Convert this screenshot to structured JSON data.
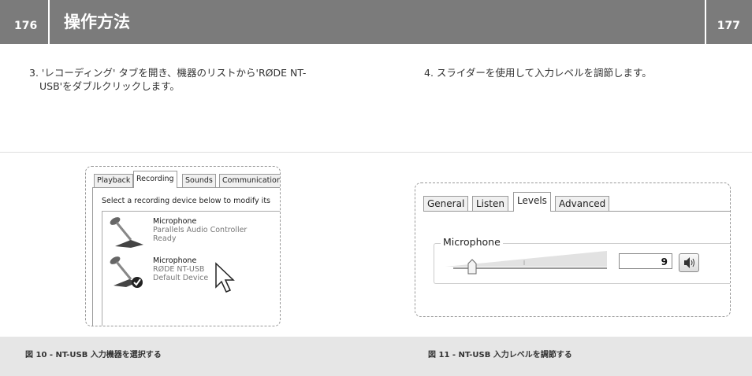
{
  "header": {
    "page_left": "176",
    "page_right": "177",
    "title": "操作方法"
  },
  "steps": [
    {
      "num": "3.",
      "text_line1": "'レコーディング' タブを開き、機器のリストから'RØDE NT-",
      "text_line2": "USB'をダブルクリックします。"
    },
    {
      "num": "4.",
      "text": "スライダーを使用して入力レベルを調節します。"
    }
  ],
  "recording_dialog": {
    "tabs": [
      "Playback",
      "Recording",
      "Sounds",
      "Communications"
    ],
    "active_tab": "Recording",
    "hint": "Select a recording device below to modify its",
    "devices": [
      {
        "name": "Microphone",
        "detail": "Parallels Audio Controller",
        "status": "Ready"
      },
      {
        "name": "Microphone",
        "detail": "RØDE NT-USB",
        "status": "Default Device"
      }
    ]
  },
  "levels_dialog": {
    "tabs": [
      "General",
      "Listen",
      "Levels",
      "Advanced"
    ],
    "active_tab": "Levels",
    "group_label": "Microphone",
    "level_value": "9",
    "level_fraction": 0.09
  },
  "captions": [
    "図 10 - NT-USB 入力機器を選択する",
    "図 11 - NT-USB 入力レベルを調節する"
  ],
  "colors": {
    "header_bg": "#7b7b7b",
    "caption_bg": "#e6e6e6"
  }
}
